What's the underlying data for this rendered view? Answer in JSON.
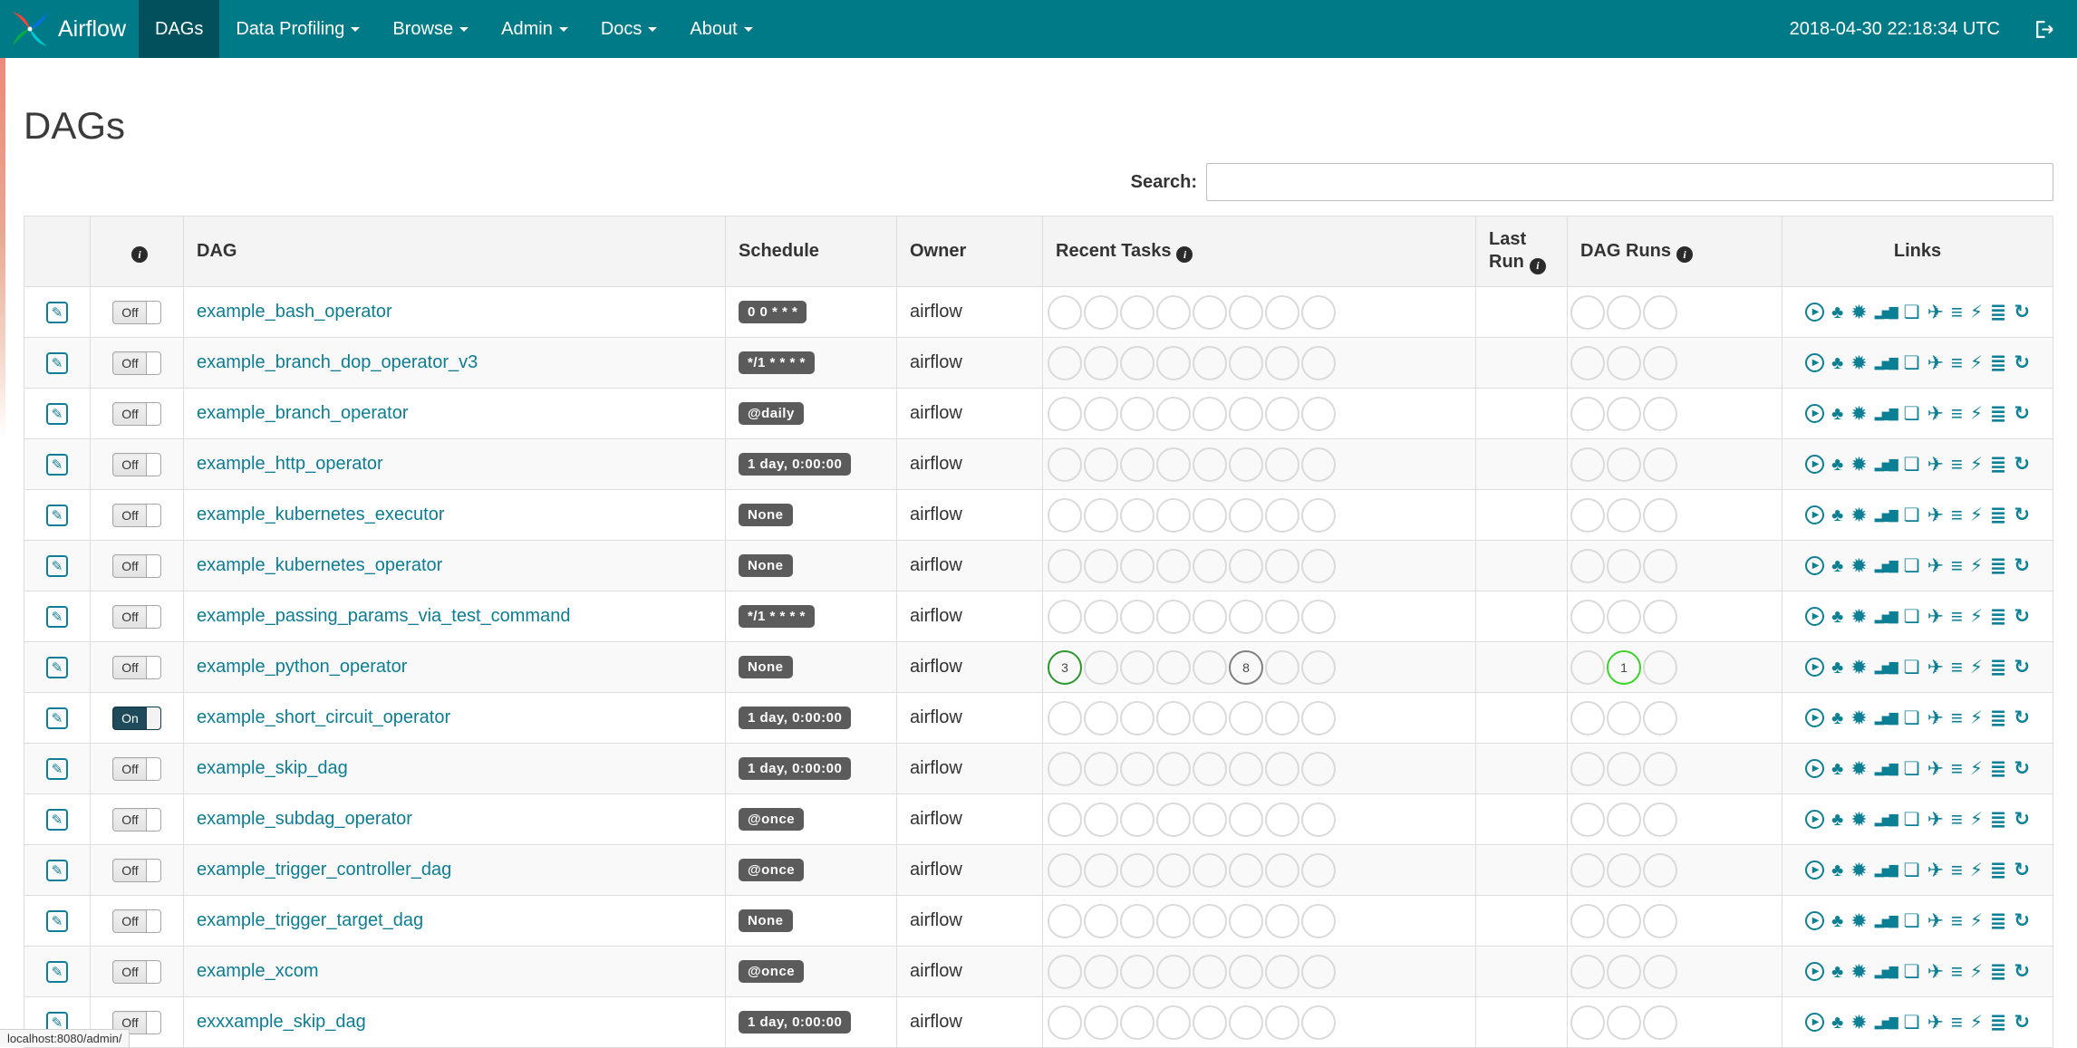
{
  "navbar": {
    "brand": "Airflow",
    "items": [
      {
        "label": "DAGs",
        "active": true,
        "dropdown": false
      },
      {
        "label": "Data Profiling",
        "active": false,
        "dropdown": true
      },
      {
        "label": "Browse",
        "active": false,
        "dropdown": true
      },
      {
        "label": "Admin",
        "active": false,
        "dropdown": true
      },
      {
        "label": "Docs",
        "active": false,
        "dropdown": true
      },
      {
        "label": "About",
        "active": false,
        "dropdown": true
      }
    ],
    "clock": "2018-04-30 22:18:34 UTC"
  },
  "page": {
    "title": "DAGs"
  },
  "search": {
    "label": "Search:",
    "value": ""
  },
  "icons": {
    "edit": "✎",
    "info": "i"
  },
  "links": [
    {
      "name": "trigger-dag-icon",
      "glyph": "▶"
    },
    {
      "name": "tree-view-icon",
      "glyph": "♣"
    },
    {
      "name": "graph-view-icon",
      "glyph": "✹"
    },
    {
      "name": "task-duration-icon",
      "glyph": "▂▅▇"
    },
    {
      "name": "task-tries-icon",
      "glyph": "❏"
    },
    {
      "name": "landing-times-icon",
      "glyph": "✈"
    },
    {
      "name": "gantt-icon",
      "glyph": "≡"
    },
    {
      "name": "code-view-icon",
      "glyph": "⚡"
    },
    {
      "name": "logs-icon",
      "glyph": "≣"
    },
    {
      "name": "refresh-icon",
      "glyph": "↻"
    }
  ],
  "table": {
    "columns": [
      {
        "name": "edit",
        "label": "",
        "info": false
      },
      {
        "name": "toggle",
        "label": "",
        "info": true
      },
      {
        "name": "dag",
        "label": "DAG",
        "info": false
      },
      {
        "name": "schedule",
        "label": "Schedule",
        "info": false
      },
      {
        "name": "owner",
        "label": "Owner",
        "info": false
      },
      {
        "name": "recent-tasks",
        "label": "Recent Tasks",
        "info": true
      },
      {
        "name": "last-run",
        "label": "Last Run",
        "info": true
      },
      {
        "name": "dag-runs",
        "label": "DAG Runs",
        "info": true
      },
      {
        "name": "links",
        "label": "Links",
        "info": false
      }
    ],
    "recent_task_slots": 8,
    "dag_run_slots": 3,
    "rows": [
      {
        "dag_id": "example_bash_operator",
        "toggle": "Off",
        "schedule": "0 0 * * *",
        "owner": "airflow",
        "last_run": "",
        "recent_tasks": [],
        "dag_runs": []
      },
      {
        "dag_id": "example_branch_dop_operator_v3",
        "toggle": "Off",
        "schedule": "*/1 * * * *",
        "owner": "airflow",
        "last_run": "",
        "recent_tasks": [],
        "dag_runs": []
      },
      {
        "dag_id": "example_branch_operator",
        "toggle": "Off",
        "schedule": "@daily",
        "owner": "airflow",
        "last_run": "",
        "recent_tasks": [],
        "dag_runs": []
      },
      {
        "dag_id": "example_http_operator",
        "toggle": "Off",
        "schedule": "1 day, 0:00:00",
        "owner": "airflow",
        "last_run": "",
        "recent_tasks": [],
        "dag_runs": []
      },
      {
        "dag_id": "example_kubernetes_executor",
        "toggle": "Off",
        "schedule": "None",
        "owner": "airflow",
        "last_run": "",
        "recent_tasks": [],
        "dag_runs": []
      },
      {
        "dag_id": "example_kubernetes_operator",
        "toggle": "Off",
        "schedule": "None",
        "owner": "airflow",
        "last_run": "",
        "recent_tasks": [],
        "dag_runs": []
      },
      {
        "dag_id": "example_passing_params_via_test_command",
        "toggle": "Off",
        "schedule": "*/1 * * * *",
        "owner": "airflow",
        "last_run": "",
        "recent_tasks": [],
        "dag_runs": []
      },
      {
        "dag_id": "example_python_operator",
        "toggle": "Off",
        "schedule": "None",
        "owner": "airflow",
        "last_run": "",
        "recent_tasks": [
          {
            "slot": 0,
            "count": "3",
            "state": "success",
            "color": "#2e962e"
          },
          {
            "slot": 5,
            "count": "8",
            "state": "queued",
            "color": "#808080"
          }
        ],
        "dag_runs": [
          {
            "slot": 1,
            "count": "1",
            "state": "running",
            "color": "#3bd42a"
          }
        ]
      },
      {
        "dag_id": "example_short_circuit_operator",
        "toggle": "On",
        "schedule": "1 day, 0:00:00",
        "owner": "airflow",
        "last_run": "",
        "recent_tasks": [],
        "dag_runs": []
      },
      {
        "dag_id": "example_skip_dag",
        "toggle": "Off",
        "schedule": "1 day, 0:00:00",
        "owner": "airflow",
        "last_run": "",
        "recent_tasks": [],
        "dag_runs": []
      },
      {
        "dag_id": "example_subdag_operator",
        "toggle": "Off",
        "schedule": "@once",
        "owner": "airflow",
        "last_run": "",
        "recent_tasks": [],
        "dag_runs": []
      },
      {
        "dag_id": "example_trigger_controller_dag",
        "toggle": "Off",
        "schedule": "@once",
        "owner": "airflow",
        "last_run": "",
        "recent_tasks": [],
        "dag_runs": []
      },
      {
        "dag_id": "example_trigger_target_dag",
        "toggle": "Off",
        "schedule": "None",
        "owner": "airflow",
        "last_run": "",
        "recent_tasks": [],
        "dag_runs": []
      },
      {
        "dag_id": "example_xcom",
        "toggle": "Off",
        "schedule": "@once",
        "owner": "airflow",
        "last_run": "",
        "recent_tasks": [],
        "dag_runs": []
      },
      {
        "dag_id": "exxxample_skip_dag",
        "toggle": "Off",
        "schedule": "1 day, 0:00:00",
        "owner": "airflow",
        "last_run": "",
        "recent_tasks": [],
        "dag_runs": []
      }
    ]
  },
  "statusbar": {
    "url": "localhost:8080/admin/"
  },
  "colors": {
    "navbar": "#007A87",
    "navbar_active": "#00515c",
    "link": "#0e7c92",
    "badge_bg": "#5b5b5b",
    "success": "#2e962e",
    "running": "#3bd42a",
    "queued": "#808080"
  }
}
